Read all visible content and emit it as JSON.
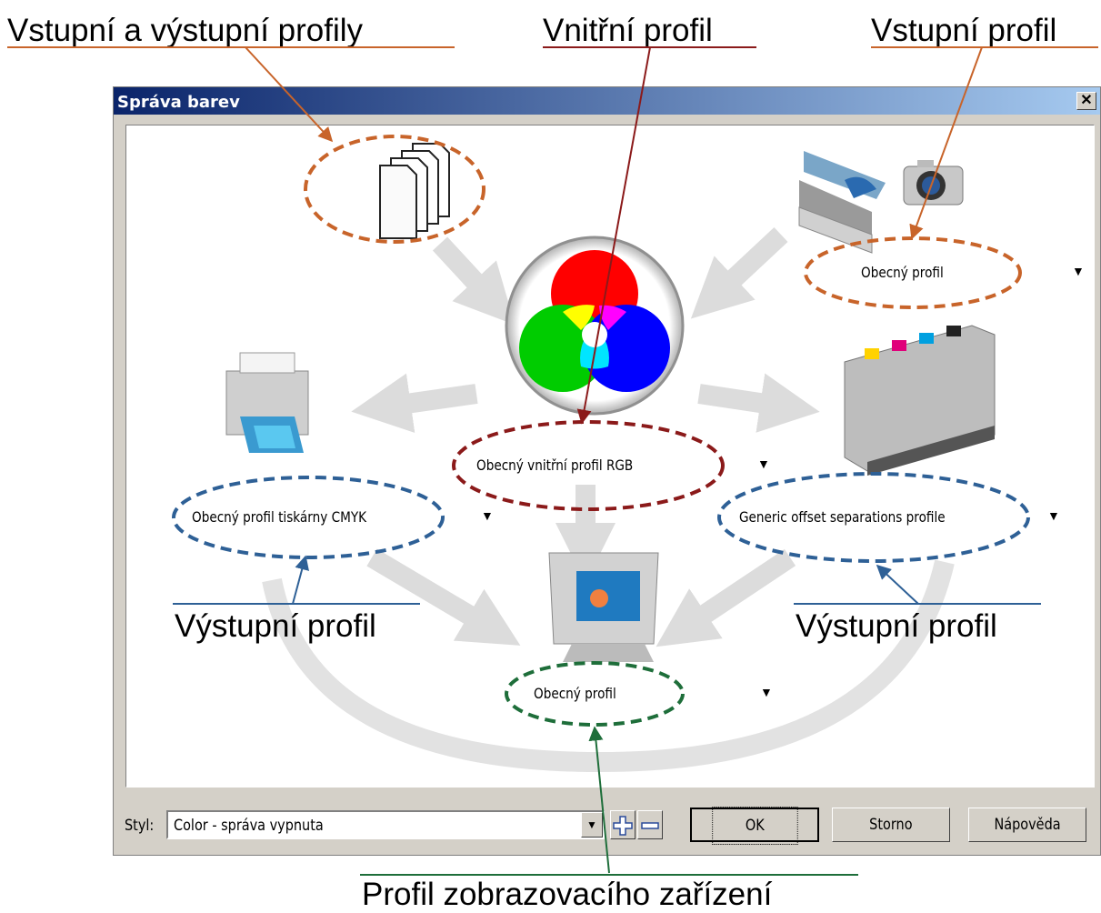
{
  "callouts": {
    "io_profiles": "Vstupní a výstupní profily",
    "internal_profile": "Vnitřní profil",
    "input_profile": "Vstupní profil",
    "output_profile_left": "Výstupní profil",
    "output_profile_right": "Výstupní profil",
    "display_profile": "Profil zobrazovacího zařízení"
  },
  "dialog": {
    "title": "Správa barev",
    "close_glyph": "✕",
    "scanner_profile": "Obecný profil",
    "internal_rgb_profile": "Obecný vnitřní profil RGB",
    "printer_profile": "Obecný profil tiskárny CMYK",
    "press_profile": "Generic offset separations profile",
    "monitor_profile": "Obecný profil",
    "dropdown_glyph": "▼",
    "style_label": "Styl:",
    "style_value": "Color - správa vypnuta",
    "ok": "OK",
    "cancel": "Storno",
    "help": "Nápověda"
  },
  "colors": {
    "orange": "#c8642a",
    "dark_red": "#8b1a1a",
    "blue": "#2e6096",
    "green": "#1e6e3a",
    "title_start": "#0a246a",
    "title_end": "#a6caf0"
  },
  "icons": [
    "documents-icon",
    "scanner-icon",
    "camera-icon",
    "rgb-circles-icon",
    "printer-icon",
    "offset-press-icon",
    "monitor-icon"
  ]
}
